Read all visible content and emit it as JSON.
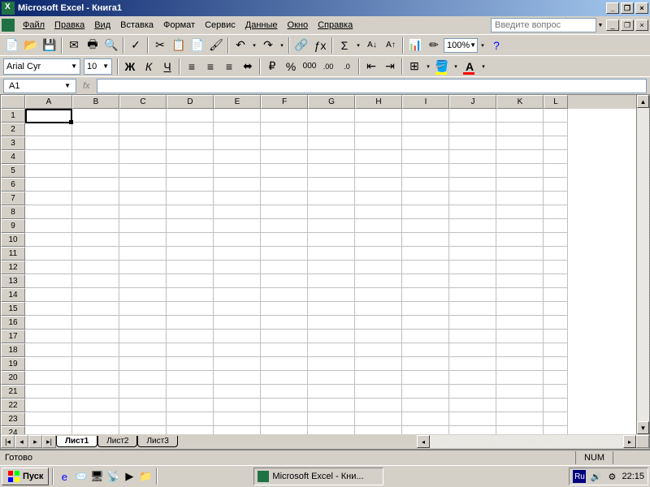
{
  "titlebar": {
    "title": "Microsoft Excel - Книга1"
  },
  "menus": {
    "file": "Файл",
    "edit": "Правка",
    "view": "Вид",
    "insert": "Вставка",
    "format": "Формат",
    "service": "Сервис",
    "data": "Данные",
    "window": "Окно",
    "help": "Справка"
  },
  "question_placeholder": "Введите вопрос",
  "font": {
    "name": "Arial Cyr",
    "size": "10"
  },
  "zoom": "100%",
  "name_box": "A1",
  "fx": "fx",
  "columns": [
    "A",
    "B",
    "C",
    "D",
    "E",
    "F",
    "G",
    "H",
    "I",
    "J",
    "K",
    "L"
  ],
  "rows": [
    "1",
    "2",
    "3",
    "4",
    "5",
    "6",
    "7",
    "8",
    "9",
    "10",
    "11",
    "12",
    "13",
    "14",
    "15",
    "16",
    "17",
    "18",
    "19",
    "20",
    "21",
    "22",
    "23",
    "24"
  ],
  "sheets": {
    "s1": "Лист1",
    "s2": "Лист2",
    "s3": "Лист3"
  },
  "status": {
    "ready": "Готово",
    "num": "NUM"
  },
  "taskbar": {
    "start": "Пуск",
    "task": "Microsoft Excel - Кни...",
    "lang": "Ru",
    "clock": "22:15"
  }
}
